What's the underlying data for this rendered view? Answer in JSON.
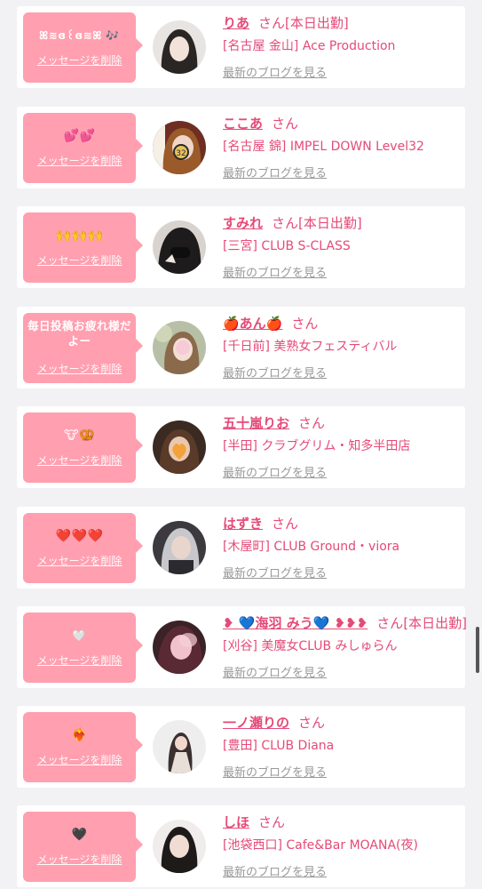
{
  "delete_label": "メッセージを削除",
  "blog_label": "最新のブログを見る",
  "items": [
    {
      "message": "ꕤ≋ɞ꒰ɞ≋ꕤ 🎶",
      "name": "りあ",
      "san": "さん",
      "badge": "[本日出勤]",
      "shop": "[名古屋 金山] Ace Production"
    },
    {
      "message": "💕💕",
      "name": "ここあ",
      "san": "さん",
      "badge": "",
      "shop": "[名古屋 錦] IMPEL DOWN Level32"
    },
    {
      "message": "🙌🙌🙌",
      "name": "すみれ",
      "san": "さん",
      "badge": "[本日出勤]",
      "shop": "[三宮] CLUB S-CLASS"
    },
    {
      "message": "毎日投稿お疲れ様だよー",
      "name": "🍎あん🍎",
      "san": "さん",
      "badge": "",
      "shop": "[千日前] 美熟女フェスティバル"
    },
    {
      "message": "🐮🥨",
      "name": "五十嵐りお",
      "san": "さん",
      "badge": "",
      "shop": "[半田] クラブグリム・知多半田店"
    },
    {
      "message": "❤️❤️❤️",
      "name": "はずき",
      "san": "さん",
      "badge": "",
      "shop": "[木屋町] CLUB Ground・viora"
    },
    {
      "message": "🤍",
      "name": "❥ 💙海羽 みう💙 ❥❥❥",
      "san": "さん",
      "badge": "[本日出勤]",
      "shop": "[刈谷] 美魔女CLUB みしゅらん"
    },
    {
      "message": "❤️‍🔥",
      "name": "一ノ瀬りの",
      "san": "さん",
      "badge": "",
      "shop": "[豊田] CLUB Diana"
    },
    {
      "message": "🖤",
      "name": "しほ",
      "san": "さん",
      "badge": "",
      "shop": "[池袋西口] Cafe&Bar MOANA(夜)"
    }
  ]
}
